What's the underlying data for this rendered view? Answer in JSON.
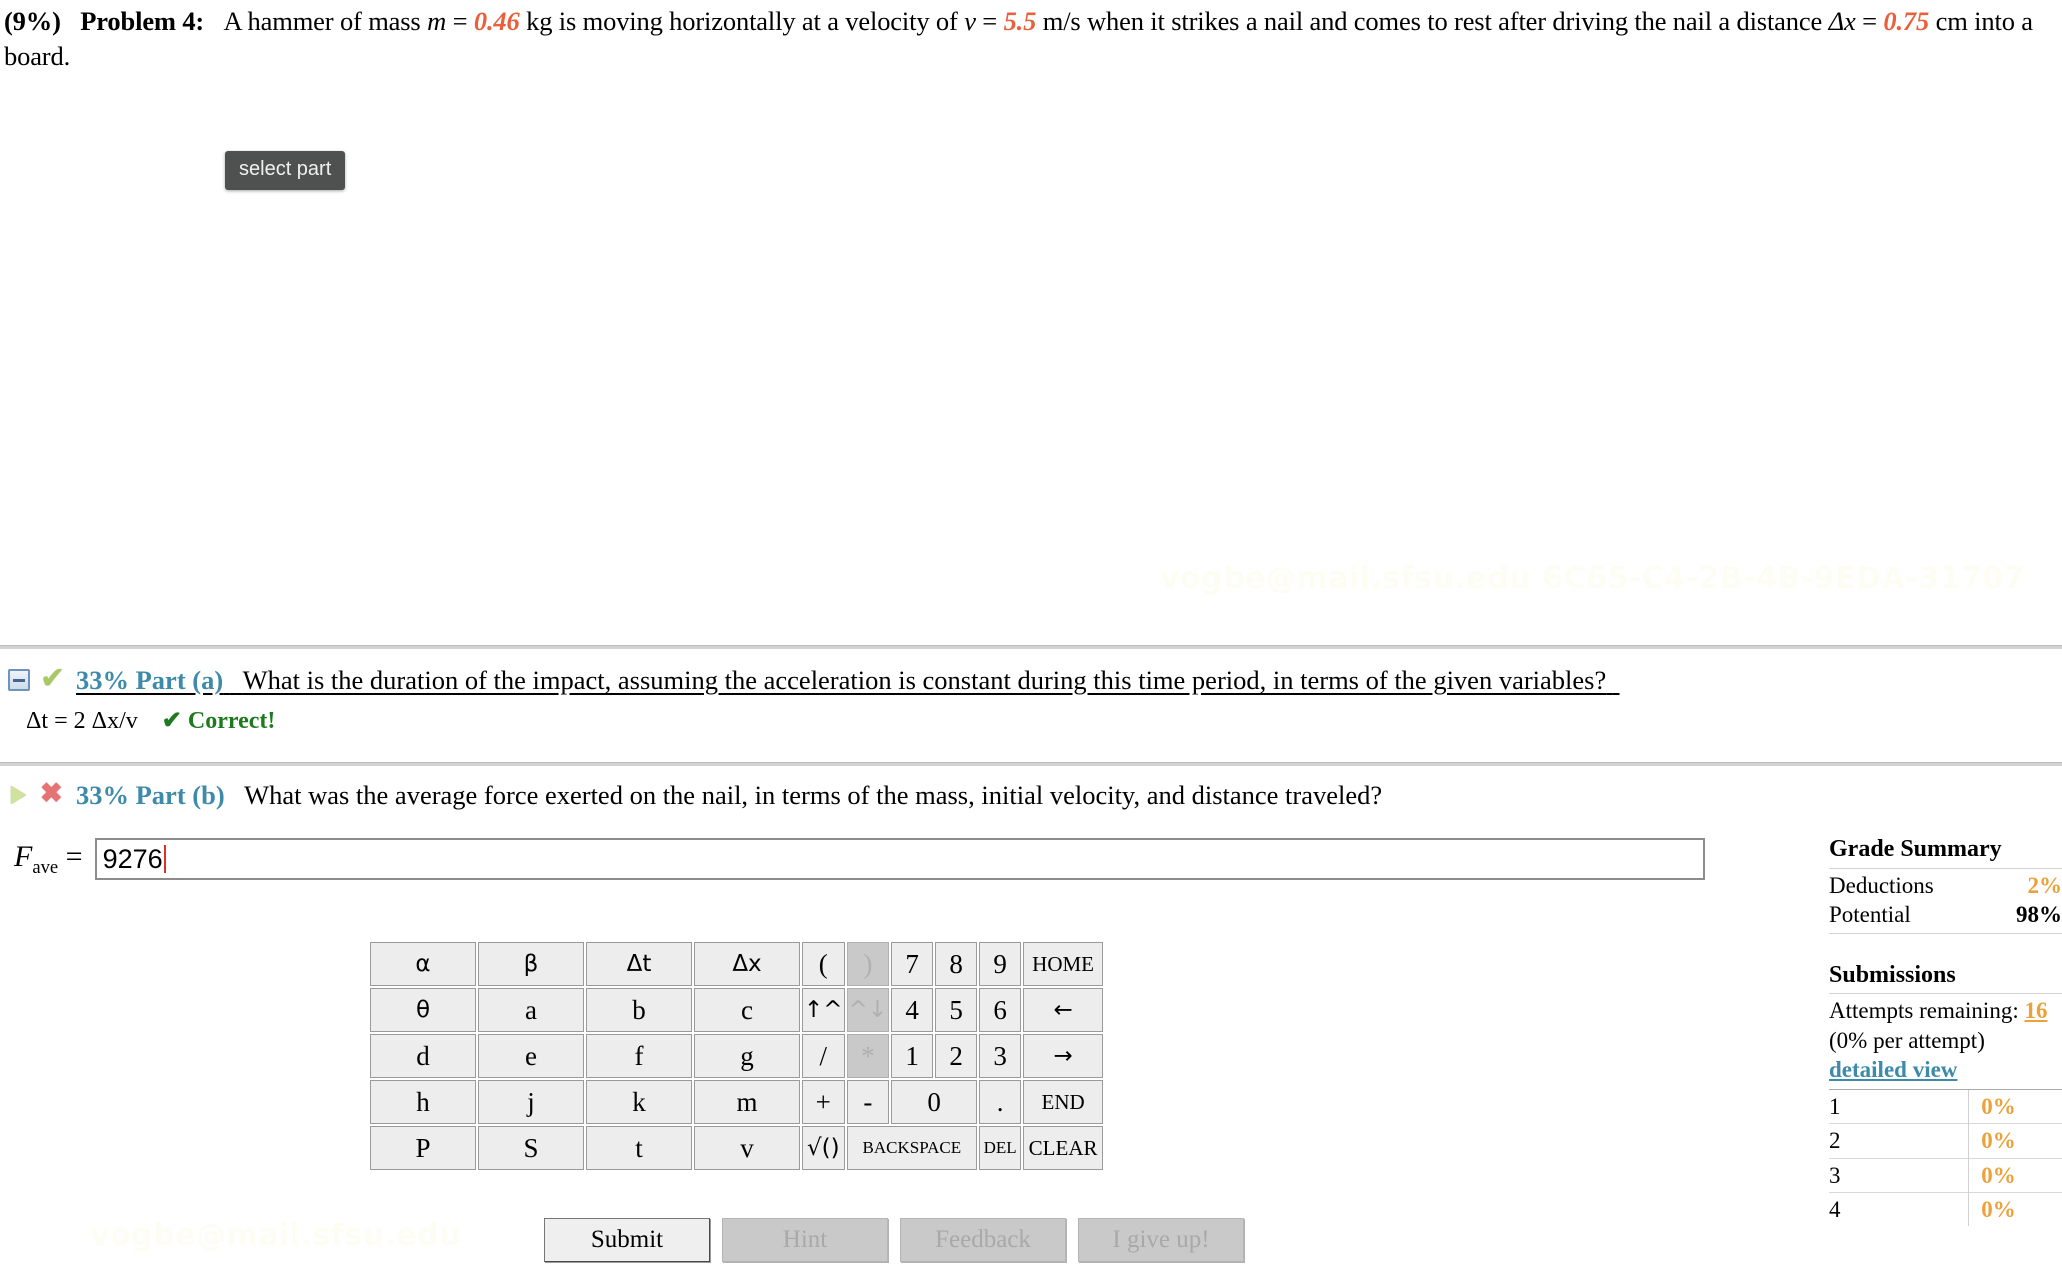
{
  "problem": {
    "percent": "(9%)",
    "label": "Problem 4:",
    "text_1": "A hammer of mass",
    "var_m": "m",
    "eq1": " = ",
    "val_m": "0.46",
    "text_2": " kg is moving horizontally at a velocity of ",
    "var_v": "v",
    "eq2": " = ",
    "val_v": "5.5",
    "text_3": " m/s when it strikes a nail and comes to rest after driving the nail a distance ",
    "var_dx": "Δx",
    "eq3": " = ",
    "val_dx": "0.75",
    "text_4": " cm into a board."
  },
  "tooltip": {
    "select_part": "select part"
  },
  "watermark": {
    "top": "vogbe@mail.sfsu.edu 6C65-C4-2B-4B-9EDA-31707",
    "bottom": "vogbe@mail.sfsu.edu"
  },
  "part_a": {
    "weight": "33% Part (a)",
    "question": "What is the duration of the impact, assuming the acceleration is constant during this time period, in terms of the given variables?",
    "answer": "Δt = 2 Δx/v",
    "status": "✔ Correct!",
    "toggle_icon": "collapse-box-icon",
    "status_icon": "green-check-icon"
  },
  "part_b": {
    "weight": "33% Part (b)",
    "question": "What was the average force exerted on the nail, in terms of the mass, initial velocity, and distance traveled?",
    "answer_label_main": "F",
    "answer_label_sub": "ave",
    "answer_label_eq": " = ",
    "answer_value": "9276",
    "toggle_icon": "expand-triangle-icon",
    "status_icon": "red-x-icon"
  },
  "keypad": {
    "rows": [
      [
        {
          "label": "α",
          "type": "wide"
        },
        {
          "label": "β",
          "type": "wide"
        },
        {
          "label": "Δt",
          "type": "wide"
        },
        {
          "label": "Δx",
          "type": "wide"
        },
        {
          "label": "(",
          "type": "op"
        },
        {
          "label": ")",
          "type": "op",
          "disabled": true
        },
        {
          "label": "7",
          "type": "digit"
        },
        {
          "label": "8",
          "type": "digit"
        },
        {
          "label": "9",
          "type": "digit"
        },
        {
          "label": "HOME",
          "type": "nav"
        }
      ],
      [
        {
          "label": "θ",
          "type": "wide"
        },
        {
          "label": "a",
          "type": "wide"
        },
        {
          "label": "b",
          "type": "wide"
        },
        {
          "label": "c",
          "type": "wide"
        },
        {
          "label": "↑^",
          "type": "op"
        },
        {
          "label": "^↓",
          "type": "op",
          "disabled": true
        },
        {
          "label": "4",
          "type": "digit"
        },
        {
          "label": "5",
          "type": "digit"
        },
        {
          "label": "6",
          "type": "digit"
        },
        {
          "label": "←",
          "type": "nav"
        }
      ],
      [
        {
          "label": "d",
          "type": "wide"
        },
        {
          "label": "e",
          "type": "wide"
        },
        {
          "label": "f",
          "type": "wide"
        },
        {
          "label": "g",
          "type": "wide"
        },
        {
          "label": "/",
          "type": "op"
        },
        {
          "label": "*",
          "type": "op",
          "disabled": true
        },
        {
          "label": "1",
          "type": "digit"
        },
        {
          "label": "2",
          "type": "digit"
        },
        {
          "label": "3",
          "type": "digit"
        },
        {
          "label": "→",
          "type": "nav"
        }
      ],
      [
        {
          "label": "h",
          "type": "wide"
        },
        {
          "label": "j",
          "type": "wide"
        },
        {
          "label": "k",
          "type": "wide"
        },
        {
          "label": "m",
          "type": "wide"
        },
        {
          "label": "+",
          "type": "op"
        },
        {
          "label": "-",
          "type": "op"
        },
        {
          "label": "0",
          "type": "digit",
          "colspan": 2
        },
        {
          "label": ".",
          "type": "digit"
        },
        {
          "label": "END",
          "type": "nav"
        }
      ],
      [
        {
          "label": "P",
          "type": "wide"
        },
        {
          "label": "S",
          "type": "wide"
        },
        {
          "label": "t",
          "type": "wide"
        },
        {
          "label": "v",
          "type": "wide"
        },
        {
          "label": "√()",
          "type": "op"
        },
        {
          "label": "BACKSPACE",
          "type": "small",
          "colspan": 3
        },
        {
          "label": "DEL",
          "type": "small"
        },
        {
          "label": "CLEAR",
          "type": "nav"
        }
      ]
    ]
  },
  "actions": [
    {
      "label": "Submit",
      "disabled": false
    },
    {
      "label": "Hint",
      "disabled": true
    },
    {
      "label": "Feedback",
      "disabled": true
    },
    {
      "label": "I give up!",
      "disabled": true
    }
  ],
  "grade_summary": {
    "title": "Grade Summary",
    "deductions_label": "Deductions",
    "deductions_value": "2%",
    "potential_label": "Potential",
    "potential_value": "98%",
    "submissions_title": "Submissions",
    "attempts_label": "Attempts remaining:",
    "attempts_value": "16",
    "per_attempt_open": "(",
    "per_attempt_value": "0%",
    "per_attempt_text": " per attempt)",
    "detailed_view": "detailed view",
    "attempts": [
      {
        "n": "1",
        "score": "0%"
      },
      {
        "n": "2",
        "score": "0%"
      },
      {
        "n": "3",
        "score": "0%"
      },
      {
        "n": "4",
        "score": "0%"
      }
    ]
  },
  "colors": {
    "accent_orange": "#eda13a",
    "value_red": "#e8603c",
    "link_blue": "#3d8aab",
    "correct_green": "#1f7a1f"
  }
}
